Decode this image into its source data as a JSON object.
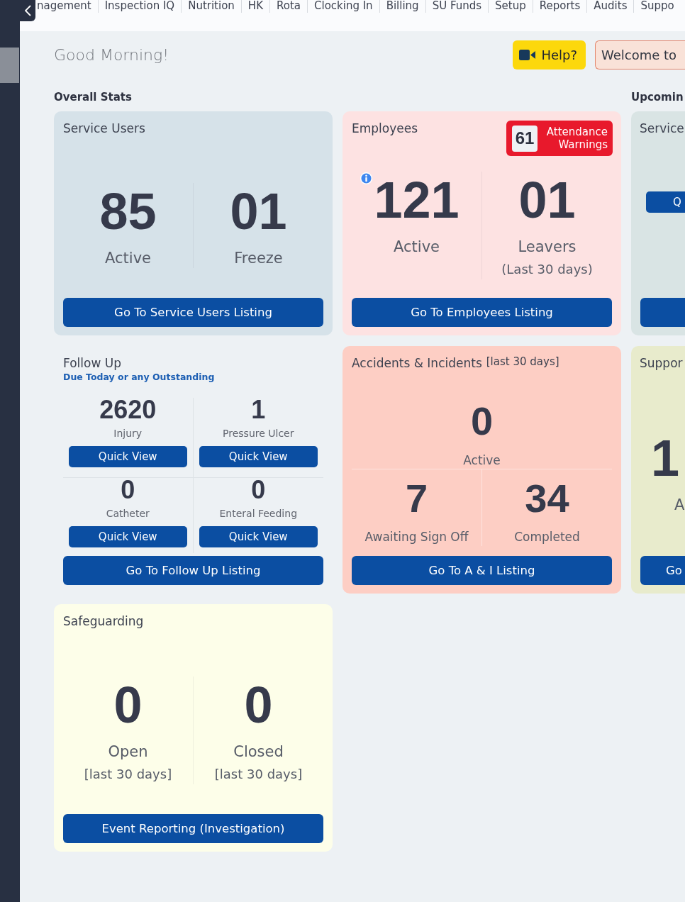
{
  "sidebar": {
    "items": [
      {
        "selected": true
      }
    ]
  },
  "top_nav": {
    "items": [
      "nagement",
      "Inspection IQ",
      "Nutrition",
      "HK",
      "Rota",
      "Clocking In",
      "Billing",
      "SU Funds",
      "Setup",
      "Reports",
      "Audits",
      "Suppo"
    ]
  },
  "header": {
    "greeting": "Good Morning!",
    "buttons": [
      {
        "kind": "help",
        "label": "Help?"
      },
      {
        "kind": "welcome",
        "label": "Welcome to"
      }
    ]
  },
  "overall_stats": {
    "title": "Overall Stats",
    "cards": [
      {
        "kind": "split",
        "title": "Service Users",
        "color": "#d6e2e9",
        "stats": [
          {
            "value": "85",
            "label": "Active"
          },
          {
            "value": "01",
            "label": "Freeze"
          }
        ],
        "button": "Go To Service Users Listing"
      },
      {
        "kind": "split",
        "title": "Employees",
        "color": "#fde2e2",
        "badge": {
          "count": "61",
          "label": "Attendance Warnings"
        },
        "stats": [
          {
            "value": "121",
            "label": "Active",
            "info": true
          },
          {
            "value": "01",
            "label": "Leavers",
            "note": "(Last 30 days)"
          }
        ],
        "button": "Go To Employees Listing"
      },
      {
        "kind": "grid",
        "title": "Follow Up",
        "subtitle": "Due Today or any Outstanding",
        "stats": [
          {
            "value": "2620",
            "label": "Injury",
            "button": "Quick View"
          },
          {
            "value": "1",
            "label": "Pressure Ulcer",
            "button": "Quick View"
          },
          {
            "value": "0",
            "label": "Catheter",
            "button": "Quick View"
          },
          {
            "value": "0",
            "label": "Enteral Feeding",
            "button": "Quick View"
          }
        ],
        "button": "Go To Follow Up Listing"
      },
      {
        "kind": "headline",
        "title": "Accidents & Incidents",
        "title_note": "[last 30 days]",
        "color": "#fdcec4",
        "headline": {
          "value": "0",
          "label": "Active"
        },
        "stats": [
          {
            "value": "7",
            "label": "Awaiting Sign Off"
          },
          {
            "value": "34",
            "label": "Completed"
          }
        ],
        "button": "Go To A & I Listing"
      },
      {
        "kind": "split",
        "title": "Safeguarding",
        "color": "#fdfee9",
        "stats": [
          {
            "value": "0",
            "label": "Open",
            "note": "[last 30 days]"
          },
          {
            "value": "0",
            "label": "Closed",
            "note": "[last 30 days]"
          }
        ],
        "button": "Event Reporting (Investigation)"
      }
    ]
  },
  "upcoming": {
    "title": "Upcomin",
    "cards": [
      {
        "title": "Service",
        "color": "#d9e4e4",
        "buttons": [
          {
            "kind": "quick",
            "label": "Q"
          },
          {
            "kind": "listing"
          }
        ]
      },
      {
        "title": "Suppor",
        "color": "#e8ebcc",
        "stats": [
          {
            "value": "1",
            "label": "A"
          }
        ],
        "buttons": [
          {
            "kind": "listing",
            "label": "Go"
          }
        ]
      }
    ]
  }
}
